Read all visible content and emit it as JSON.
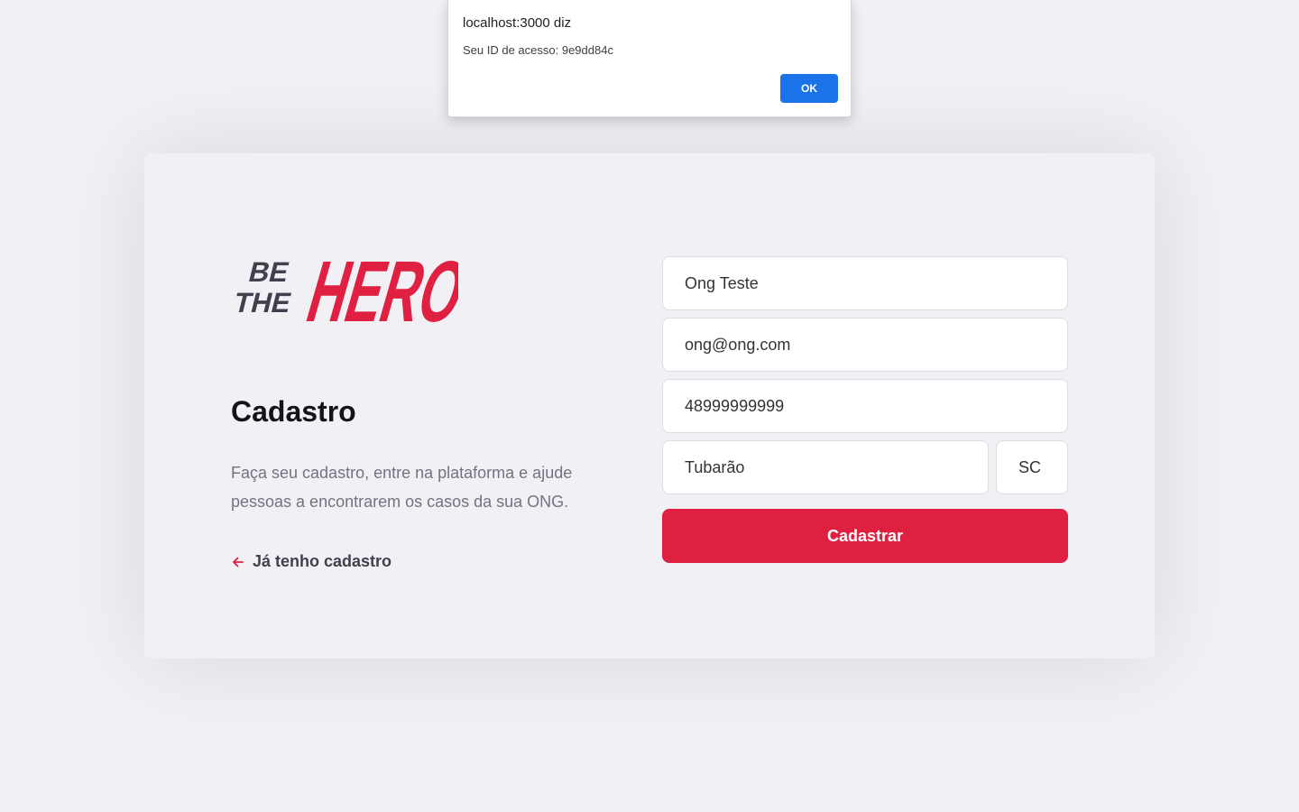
{
  "alert": {
    "title": "localhost:3000 diz",
    "message": "Seu ID de acesso: 9e9dd84c",
    "ok_label": "OK"
  },
  "logo": {
    "small_line1": "BE",
    "small_line2": "THE",
    "big": "HERO",
    "colors": {
      "dark": "#41414d",
      "brand": "#e02041"
    }
  },
  "register": {
    "title": "Cadastro",
    "description": "Faça seu cadastro, entre na plataforma e ajude pessoas a encontrarem os casos da sua ONG.",
    "back_link_label": "Já tenho cadastro",
    "back_icon": "arrow-left-icon"
  },
  "form": {
    "name": "Ong Teste",
    "email": "ong@ong.com",
    "whatsapp": "48999999999",
    "city": "Tubarão",
    "uf": "SC",
    "submit_label": "Cadastrar"
  },
  "colors": {
    "background": "#f0f0f5",
    "accent": "#e02041",
    "dialog_button": "#1a73e8"
  }
}
